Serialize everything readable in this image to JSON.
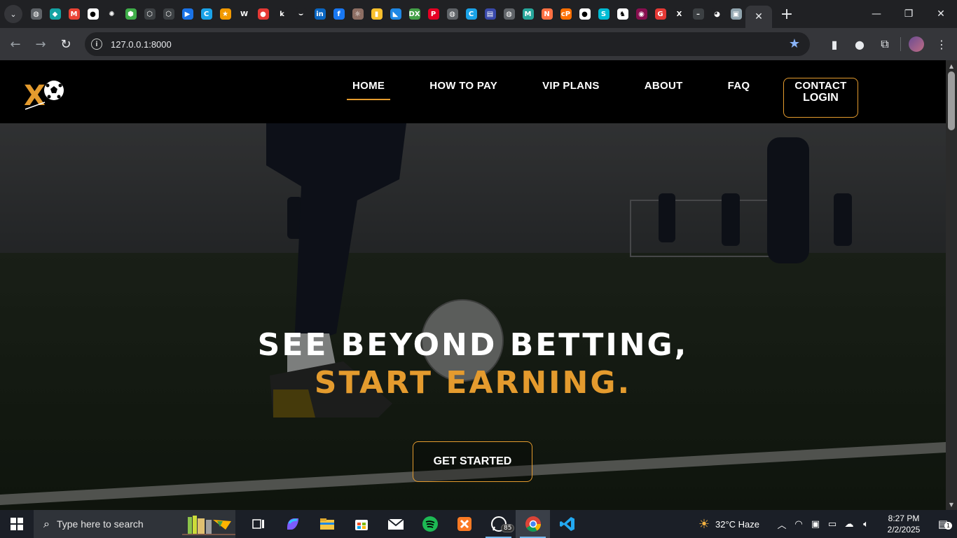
{
  "browser": {
    "pinned_tabs": [
      {
        "name": "globe-favicon",
        "color": "#5f6368",
        "glyph": "◍"
      },
      {
        "name": "binance-favicon",
        "color": "#14a3a3",
        "glyph": "◆"
      },
      {
        "name": "gmail-favicon",
        "color": "#ea4335",
        "glyph": "M"
      },
      {
        "name": "panda-favicon",
        "color": "#ffffff",
        "glyph": "●"
      },
      {
        "name": "openai-favicon",
        "color": "#202124",
        "glyph": "✺"
      },
      {
        "name": "cube-favicon",
        "color": "#3fae49",
        "glyph": "⬢"
      },
      {
        "name": "hex-favicon",
        "color": "#3c4043",
        "glyph": "⬡"
      },
      {
        "name": "hex2-favicon",
        "color": "#3c4043",
        "glyph": "⬡"
      },
      {
        "name": "arrow-favicon",
        "color": "#1a73e8",
        "glyph": "▶"
      },
      {
        "name": "c-favicon",
        "color": "#1aa3e8",
        "glyph": "C"
      },
      {
        "name": "star-favicon",
        "color": "#f29900",
        "glyph": "★"
      },
      {
        "name": "w-favicon",
        "color": "#202124",
        "glyph": "W"
      },
      {
        "name": "record-favicon",
        "color": "#e53935",
        "glyph": "●"
      },
      {
        "name": "k-favicon",
        "color": "#202124",
        "glyph": "k"
      },
      {
        "name": "amazon-favicon",
        "color": "#202124",
        "glyph": "⌣"
      },
      {
        "name": "linkedin-favicon",
        "color": "#0a66c2",
        "glyph": "in"
      },
      {
        "name": "facebook-favicon",
        "color": "#1877f2",
        "glyph": "f"
      },
      {
        "name": "sun-favicon",
        "color": "#8d6e63",
        "glyph": "☼"
      },
      {
        "name": "flag-favicon",
        "color": "#fbc02d",
        "glyph": "▮"
      },
      {
        "name": "bluesky-favicon",
        "color": "#1e88e5",
        "glyph": "◣"
      },
      {
        "name": "dx-favicon",
        "color": "#43a047",
        "glyph": "DX"
      },
      {
        "name": "pinterest-favicon",
        "color": "#e60023",
        "glyph": "P"
      },
      {
        "name": "globe2-favicon",
        "color": "#5f6368",
        "glyph": "◍"
      },
      {
        "name": "c2-favicon",
        "color": "#1aa3e8",
        "glyph": "C"
      },
      {
        "name": "print-favicon",
        "color": "#3949ab",
        "glyph": "▤"
      },
      {
        "name": "globe3-favicon",
        "color": "#5f6368",
        "glyph": "◍"
      },
      {
        "name": "m-favicon",
        "color": "#26a69a",
        "glyph": "M"
      },
      {
        "name": "n-favicon",
        "color": "#ff7043",
        "glyph": "N"
      },
      {
        "name": "cp-favicon",
        "color": "#ff6f00",
        "glyph": "cP"
      },
      {
        "name": "panda2-favicon",
        "color": "#ffffff",
        "glyph": "●"
      },
      {
        "name": "s-favicon",
        "color": "#00bcd4",
        "glyph": "S"
      },
      {
        "name": "cat-favicon",
        "color": "#ffffff",
        "glyph": "♞"
      },
      {
        "name": "eye-favicon",
        "color": "#880e4f",
        "glyph": "◉"
      },
      {
        "name": "g-favicon",
        "color": "#e53935",
        "glyph": "G"
      },
      {
        "name": "x-favicon",
        "color": "#202124",
        "glyph": "X"
      },
      {
        "name": "dash-favicon",
        "color": "#3c4043",
        "glyph": "–"
      },
      {
        "name": "github-favicon",
        "color": "#202124",
        "glyph": "◕"
      },
      {
        "name": "profile-favicon",
        "color": "#90a4ae",
        "glyph": "▣"
      }
    ],
    "url": "127.0.0.1:8000"
  },
  "site": {
    "nav": [
      "HOME",
      "HOW TO PAY",
      "VIP PLANS",
      "ABOUT",
      "FAQ",
      "CONTACT"
    ],
    "login": "LOGIN",
    "hero_line1": "SEE BEYOND BETTING,",
    "hero_line2": "START EARNING.",
    "cta": "GET STARTED",
    "accent": "#e49b2e"
  },
  "taskbar": {
    "search_placeholder": "Type here to search",
    "whatsapp_badge": "85",
    "weather": "32°C  Haze",
    "time": "8:27 PM",
    "date": "2/2/2025",
    "notifications": "1"
  }
}
